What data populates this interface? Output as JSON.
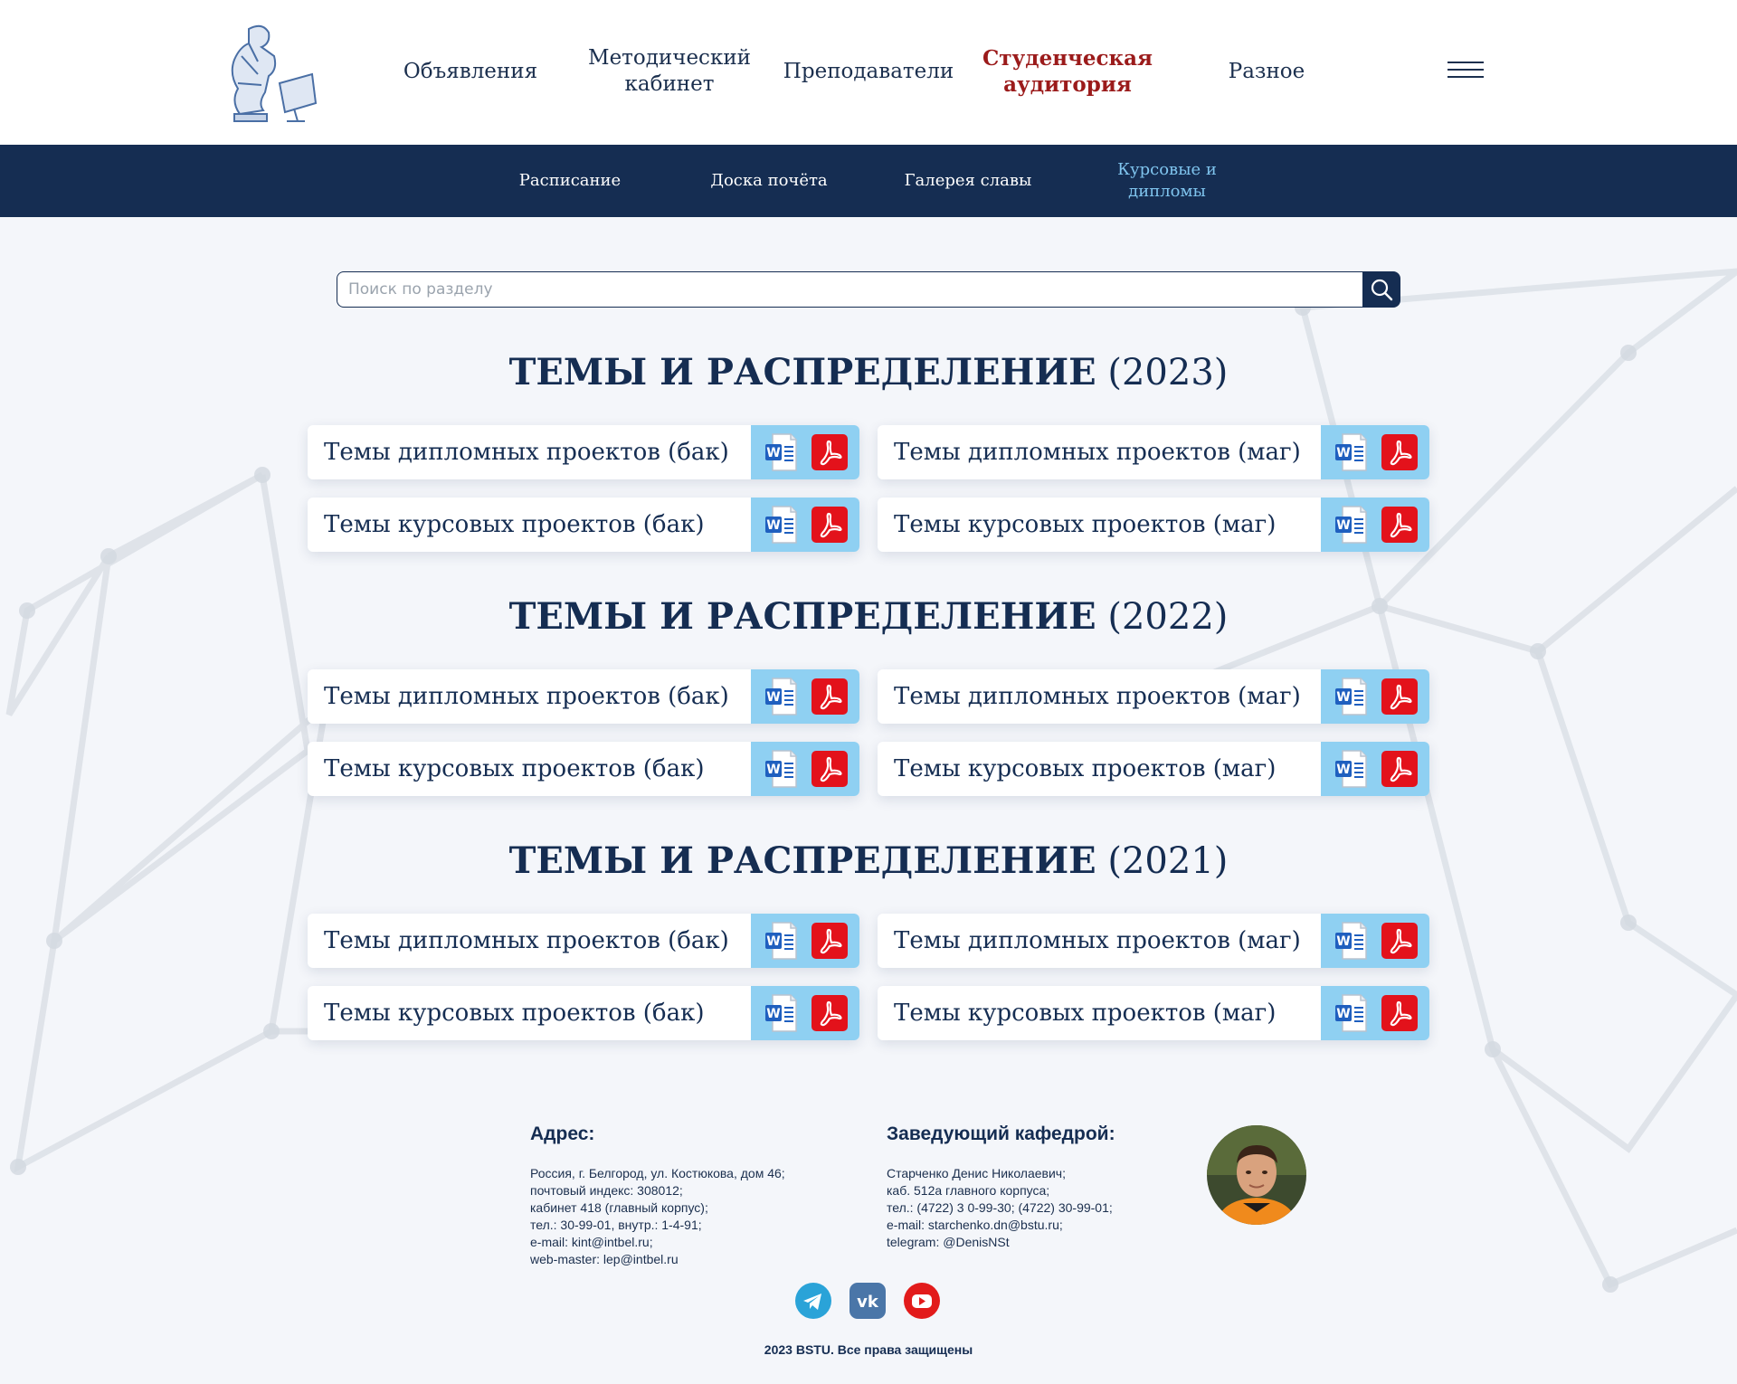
{
  "nav": {
    "items": [
      {
        "label": "Объявления"
      },
      {
        "label": "Методический кабинет"
      },
      {
        "label": "Преподаватели"
      },
      {
        "label": "Студенческая аудитория"
      },
      {
        "label": "Разное"
      }
    ],
    "active": "Студенческая аудитория"
  },
  "subnav": {
    "items": [
      {
        "label": "Расписание"
      },
      {
        "label": "Доска почёта"
      },
      {
        "label": "Галерея славы"
      },
      {
        "label": "Курсовые и дипломы"
      }
    ],
    "active": "Курсовые и дипломы"
  },
  "search": {
    "placeholder": "Поиск по разделу"
  },
  "sections": [
    {
      "title": "ТЕМЫ И РАСПРЕДЕЛЕНИЕ",
      "year": "(2023)",
      "cards": [
        {
          "label": "Темы дипломных проектов (бак)"
        },
        {
          "label": "Темы дипломных проектов (маг)"
        },
        {
          "label": "Темы курсовых проектов (бак)"
        },
        {
          "label": "Темы курсовых проектов (маг)"
        }
      ]
    },
    {
      "title": "ТЕМЫ И РАСПРЕДЕЛЕНИЕ",
      "year": "(2022)",
      "cards": [
        {
          "label": "Темы дипломных проектов (бак)"
        },
        {
          "label": "Темы дипломных проектов (маг)"
        },
        {
          "label": "Темы курсовых проектов (бак)"
        },
        {
          "label": "Темы курсовых проектов (маг)"
        }
      ]
    },
    {
      "title": "ТЕМЫ И РАСПРЕДЕЛЕНИЕ",
      "year": "(2021)",
      "cards": [
        {
          "label": "Темы дипломных проектов (бак)"
        },
        {
          "label": "Темы дипломных проектов (маг)"
        },
        {
          "label": "Темы курсовых проектов (бак)"
        },
        {
          "label": "Темы курсовых проектов (маг)"
        }
      ]
    }
  ],
  "footer": {
    "address": {
      "heading": "Адрес:",
      "lines": [
        "Россия, г. Белгород, ул. Костюкова, дом 46;",
        "почтовый индекс: 308012;",
        "кабинет 418 (главный корпус);",
        "тел.: 30-99-01, внутр.: 1-4-91;",
        "e-mail: kint@intbel.ru;",
        "web-master: lep@intbel.ru"
      ]
    },
    "head": {
      "heading": "Заведующий кафедрой:",
      "lines": [
        "Старченко Денис Николаевич;",
        "каб. 512а главного корпуса;",
        "тел.: (4722) 3 0-99-30; (4722) 30-99-01;",
        "e-mail: starchenko.dn@bstu.ru;",
        "telegram: @DenisNSt"
      ]
    },
    "social": [
      {
        "icon": "telegram-icon",
        "color": "#2aa3d8"
      },
      {
        "icon": "vk-icon",
        "color": "#4a76a8"
      },
      {
        "icon": "youtube-icon",
        "color": "#e21b1b"
      }
    ],
    "copyright": "2023 BSTU. Все права защищены"
  },
  "colors": {
    "navy": "#152d52",
    "active_nav": "#9b1b1b",
    "active_sub": "#7fc4ee",
    "file_bg": "#8fd0f2",
    "pdf_red": "#e3121b",
    "word_blue": "#1f5fbf"
  }
}
